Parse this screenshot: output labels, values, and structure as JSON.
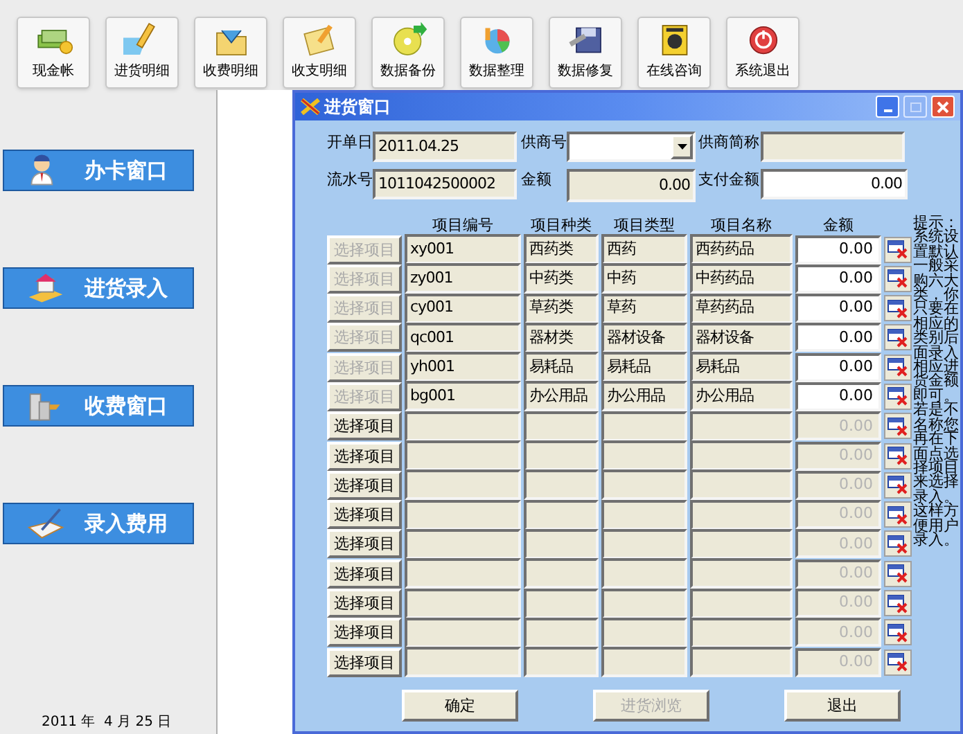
{
  "toolbar": [
    {
      "label": "现金帐"
    },
    {
      "label": "进货明细"
    },
    {
      "label": "收费明细"
    },
    {
      "label": "收支明细"
    },
    {
      "label": "数据备份"
    },
    {
      "label": "数据整理"
    },
    {
      "label": "数据修复"
    },
    {
      "label": "在线咨询"
    },
    {
      "label": "系统退出"
    }
  ],
  "nav": [
    {
      "label": "办卡窗口"
    },
    {
      "label": "进货录入"
    },
    {
      "label": "收费窗口"
    },
    {
      "label": "录入费用"
    }
  ],
  "date": "2011 年  4 月 25 日",
  "window": {
    "title": "进货窗口"
  },
  "form": {
    "date_label": "开单日",
    "date": "2011.04.25",
    "supplier_label": "供商号",
    "supplier_name_label": "供商简称",
    "serial_label": "流水号",
    "serial": "1011042500002",
    "amount_label": "金额",
    "amount": "0.00",
    "paid_label": "支付金额",
    "paid": "0.00"
  },
  "table": {
    "columns": [
      "项目编号",
      "项目种类",
      "项目类型",
      "项目名称",
      "金额"
    ],
    "rows": [
      {
        "button": "选择项目",
        "button_disabled": true,
        "code": "xy001",
        "category": "西药类",
        "type": "西药",
        "name": "西药药品",
        "amount": "0.00",
        "amount_disabled": false
      },
      {
        "button": "选择项目",
        "button_disabled": true,
        "code": "zy001",
        "category": "中药类",
        "type": "中药",
        "name": "中药药品",
        "amount": "0.00",
        "amount_disabled": false
      },
      {
        "button": "选择项目",
        "button_disabled": true,
        "code": "cy001",
        "category": "草药类",
        "type": "草药",
        "name": "草药药品",
        "amount": "0.00",
        "amount_disabled": false
      },
      {
        "button": "选择项目",
        "button_disabled": true,
        "code": "qc001",
        "category": "器材类",
        "type": "器材设备",
        "name": "器材设备",
        "amount": "0.00",
        "amount_disabled": false
      },
      {
        "button": "选择项目",
        "button_disabled": true,
        "code": "yh001",
        "category": "易耗品",
        "type": "易耗品",
        "name": "易耗品",
        "amount": "0.00",
        "amount_disabled": false
      },
      {
        "button": "选择项目",
        "button_disabled": true,
        "code": "bg001",
        "category": "办公用品",
        "type": "办公用品",
        "name": "办公用品",
        "amount": "0.00",
        "amount_disabled": false
      },
      {
        "button": "选择项目",
        "button_disabled": false,
        "amount": "0.00",
        "amount_disabled": true
      },
      {
        "button": "选择项目",
        "button_disabled": false,
        "amount": "0.00",
        "amount_disabled": true
      },
      {
        "button": "选择项目",
        "button_disabled": false,
        "amount": "0.00",
        "amount_disabled": true
      },
      {
        "button": "选择项目",
        "button_disabled": false,
        "amount": "0.00",
        "amount_disabled": true
      },
      {
        "button": "选择项目",
        "button_disabled": false,
        "amount": "0.00",
        "amount_disabled": true
      },
      {
        "button": "选择项目",
        "button_disabled": false,
        "amount": "0.00",
        "amount_disabled": true
      },
      {
        "button": "选择项目",
        "button_disabled": false,
        "amount": "0.00",
        "amount_disabled": true
      },
      {
        "button": "选择项目",
        "button_disabled": false,
        "amount": "0.00",
        "amount_disabled": true
      },
      {
        "button": "选择项目",
        "button_disabled": false,
        "amount": "0.00",
        "amount_disabled": true
      }
    ]
  },
  "hint": "提示：系统设置默认一般采购六大类，你只要在相应的类别后面录入相应进货金额即可。若是不名称您再在下面点选择项目来选择录入。这样方便用户录入。",
  "buttons": [
    {
      "label": "确定",
      "disabled": false
    },
    {
      "label": "进货浏览",
      "disabled": true
    },
    {
      "label": "退出",
      "disabled": false
    }
  ]
}
